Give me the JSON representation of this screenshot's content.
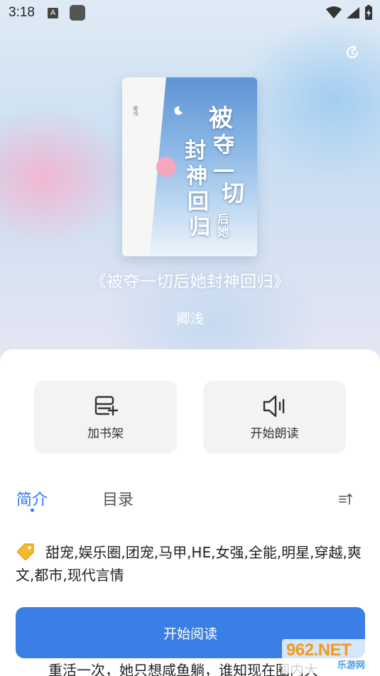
{
  "status_bar": {
    "time": "3:18",
    "notification_icon_text": "A"
  },
  "book": {
    "cover_title_lines": [
      "被",
      "夺",
      "一",
      "切",
      "后",
      "她",
      "封",
      "神",
      "回",
      "归"
    ],
    "cover_small_text": "卿浅",
    "title": "《被夺一切后她封神回归》",
    "author": "卿浅"
  },
  "actions": {
    "add_to_shelf": "加书架",
    "start_listening": "开始朗读"
  },
  "tabs": {
    "intro": "简介",
    "catalog": "目录"
  },
  "tags": "甜宠,娱乐圈,团宠,马甲,HE,女强,全能,明星,穿越,爽文,都市,现代言情",
  "intro_preview": "重活一次，她只想咸鱼躺，谁知现在圈内大",
  "primary_button": "开始阅读",
  "watermark": {
    "main": "962.NET",
    "sub": "乐游网"
  },
  "colors": {
    "accent": "#3a7fe6",
    "tab_active": "#2f7bf0",
    "card_bg": "#f3f3f4"
  }
}
